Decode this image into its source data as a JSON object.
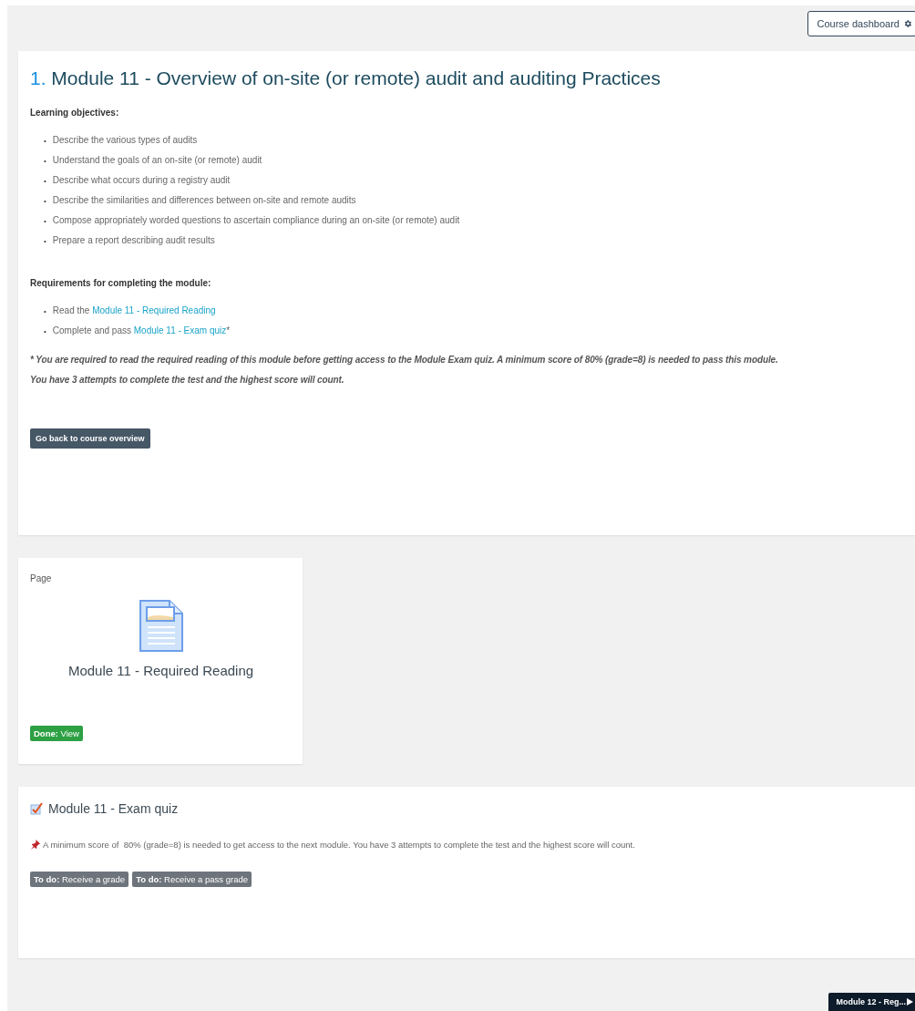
{
  "header_button": {
    "label": "Course dashboard"
  },
  "section": {
    "number": "1.",
    "title": "Module 11 - Overview of on-site (or remote) audit and auditing Practices",
    "objectives_heading": "Learning objectives:",
    "objectives": [
      {
        "bullet": "•",
        "text": "Describe the various types of audits"
      },
      {
        "bullet": "•",
        "text": "Understand the goals of an on-site (or remote) audit"
      },
      {
        "bullet": "•",
        "text": "Describe what occurs during a registry audit"
      },
      {
        "bullet": "•",
        "text": "Describe the similarities and differences between on-site and remote audits"
      },
      {
        "bullet": "•",
        "text": "Compose appropriately worded questions to ascertain compliance during an on-site (or remote) audit"
      },
      {
        "bullet": "•",
        "text": "Prepare a report describing audit results"
      }
    ],
    "requirements_heading": "Requirements for completing the module:",
    "requirements": [
      {
        "bullet": "•",
        "text": "Read the",
        "link": "Module 11 - Required Reading"
      },
      {
        "bullet": "•",
        "text": "Complete and pass",
        "link": "Module 11 - Exam quiz",
        "suffix": "*"
      }
    ],
    "note": [
      "* You are required to read the required reading of this module before getting access to the Module Exam quiz. A minimum score of 80%  (grade=8) is needed to pass this module.",
      "You have 3 attempts to complete the test and the highest score will count."
    ],
    "back_button": "Go back to course overview"
  },
  "page_card": {
    "type_label": "Page",
    "title": "Module 11 - Required Reading",
    "badges": [
      {
        "text": "**Done:** View",
        "done": true
      }
    ]
  },
  "quiz_card": {
    "title": "Module 11 - Exam quiz",
    "description": "A minimum score of  80% (grade=8) is needed to get access to the next module. You have 3 attempts to complete the test and the highest score will count.",
    "badges": [
      {
        "text": "**To do:** Receive a grade",
        "done": false
      },
      {
        "text": "**To do:** Receive a pass grade",
        "done": false
      }
    ]
  },
  "next_button": {
    "label": "Module 12 - Reg..."
  }
}
